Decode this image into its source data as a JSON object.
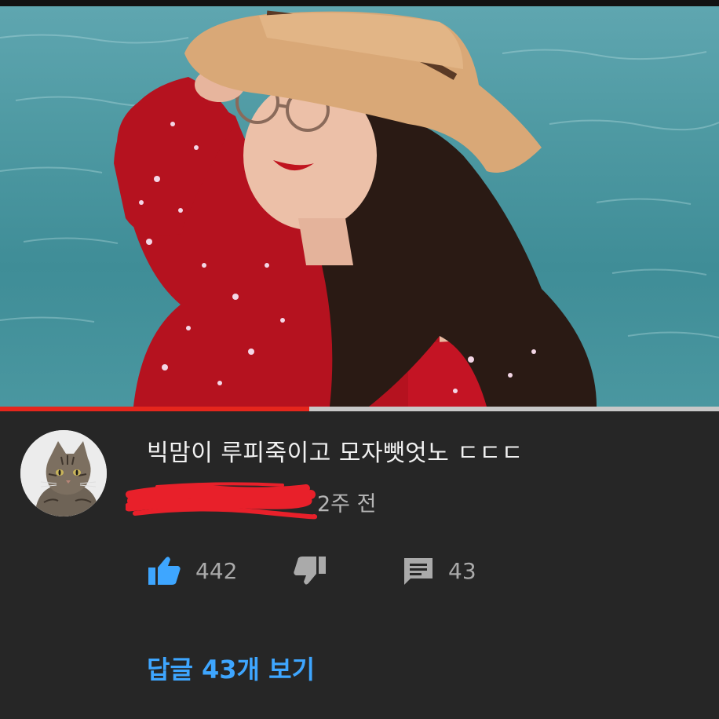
{
  "video": {
    "progress_fraction": 0.43
  },
  "comment": {
    "text": "빅맘이 루피죽이고 모자뺏엇노 ㄷㄷㄷ",
    "timestamp": "2주 전",
    "author_redacted": true,
    "avatar_icon": "cat-avatar",
    "likes": "442",
    "replies_count": "43",
    "view_replies_label": "답글 43개 보기"
  },
  "colors": {
    "panel_bg": "#262626",
    "link_blue": "#3ea6ff",
    "like_blue": "#3ea6ff",
    "progress_red": "#e5261c",
    "scribble_red": "#e8202a"
  },
  "icons": {
    "like": "thumb-up-icon",
    "dislike": "thumb-down-icon",
    "reply": "comment-icon"
  }
}
